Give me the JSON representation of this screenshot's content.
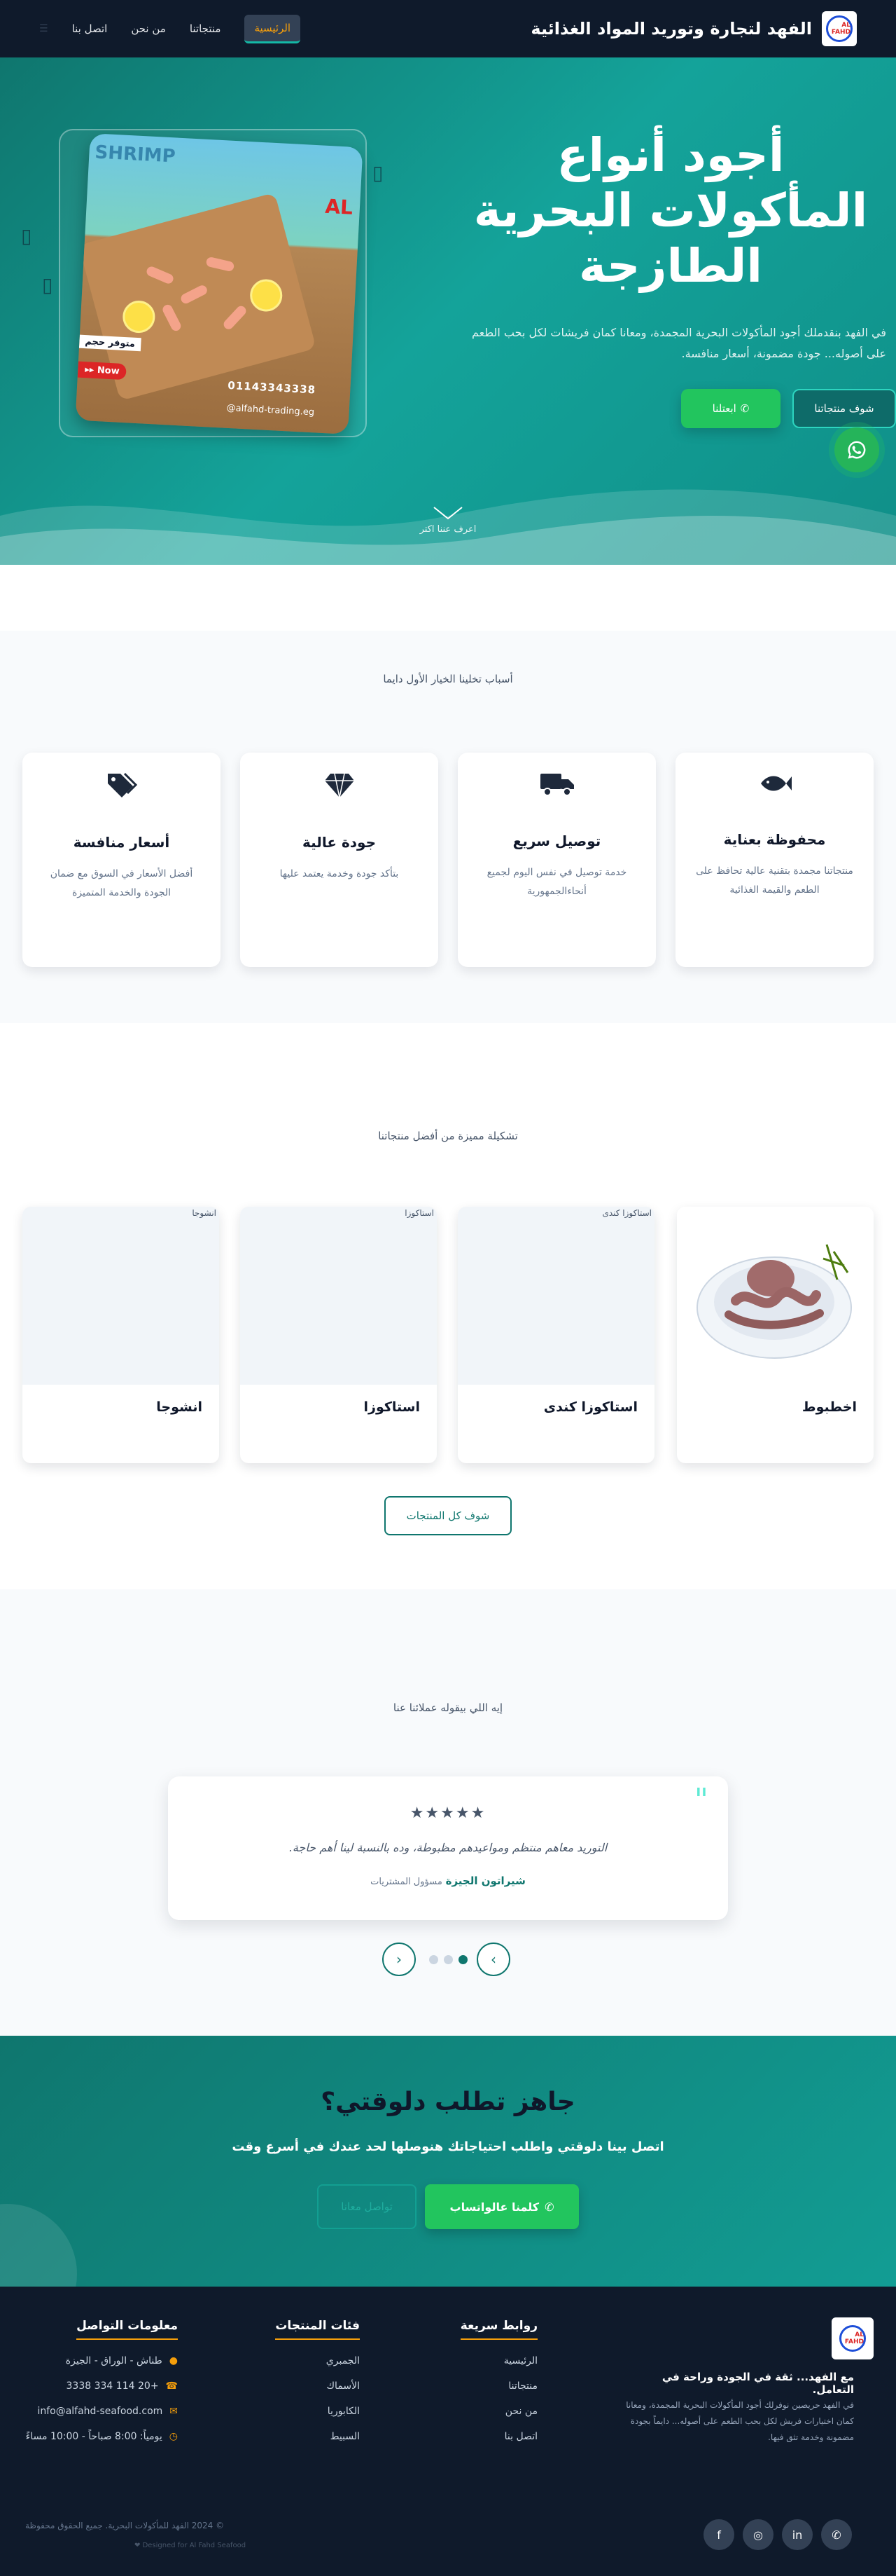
{
  "nav": {
    "brand": "الفهد لتجارة وتوريد المواد الغذائية",
    "logo_text": "AL FAHD",
    "items": [
      {
        "label": "الرئيسية",
        "active": true
      },
      {
        "label": "منتجاتنا",
        "active": false
      },
      {
        "label": "من نحن",
        "active": false
      },
      {
        "label": "اتصل بنا",
        "active": false
      }
    ]
  },
  "hero": {
    "title_line1": "أجود أنواع",
    "title_line2": "المأكولات البحرية",
    "title_line3": "الطازجة",
    "description": "في الفهد بنقدملك أجود المأكولات البحرية المجمدة، ومعانا كمان فريشات لكل بحب الطعم على أصوله... جودة مضمونة، أسعار منافسة.",
    "btn_products": "شوف منتجاتنا",
    "btn_contact": "ابعتلنا",
    "scroll_hint": "اعرف عننا اكتر",
    "image": {
      "word": "SHRIMP",
      "al": "AL",
      "tag1": "متوفر حجم",
      "tag2": "Now ▸▸",
      "phone": "01143343338",
      "site": "alfahd-trading.eg@"
    }
  },
  "why": {
    "subtitle": "أسباب تخلينا الخيار الأول دايما",
    "cards": [
      {
        "title": "محفوظة بعناية",
        "text": "منتجاتنا مجمدة بتقنية عالية تحافظ على الطعم والقيمة الغذائية"
      },
      {
        "title": "توصيل سريع",
        "text": "خدمة توصيل في نفس اليوم لجميع أنحاءالجمهورية"
      },
      {
        "title": "جودة عالية",
        "text": "بتأكد جودة وخدمة يعتمد عليها"
      },
      {
        "title": "أسعار منافسة",
        "text": "أفضل الأسعار في السوق مع ضمان الجودة والخدمة المتميزة"
      }
    ]
  },
  "products": {
    "subtitle": "تشكيلة مميزة من أفضل منتجاتنا",
    "items": [
      {
        "name": "اخطبوط",
        "alt": ""
      },
      {
        "name": "استاكوزا كندى",
        "alt": "استاكوزا كندى"
      },
      {
        "name": "استاكوزا",
        "alt": "استاكوزا"
      },
      {
        "name": "انشوجا",
        "alt": "انشوجا"
      }
    ],
    "btn_all": "شوف كل المنتجات"
  },
  "testimonials": {
    "subtitle": "إيه اللي بيقوله عملائنا عنا",
    "stars": "★★★★★",
    "text": "التوريد معاهم منتظم ومواعيدهم مظبوطة، وده بالنسبة لينا أهم حاجة.",
    "author": "شيراتون الجيزة",
    "role": "مسؤول المشتريات"
  },
  "cta": {
    "title": "جاهز تطلب دلوقتي؟",
    "subtitle": "اتصل بينا دلوقتي واطلب احتياجاتك هنوصلها لحد عندك في أسرع وقت",
    "btn_whatsapp": "كلمنا عالواتساب",
    "btn_message": "تواصل معانا"
  },
  "footer": {
    "tagline": "مع الفهد... ثقة في الجودة وراحة في التعامل.",
    "description": "في الفهد حريصين نوفرلك أجود المأكولات البحرية المجمدة، ومعانا كمان اختيارات فريش لكل بحب الطعم على أصوله... دايماً بجودة مضمونة وخدمة تثق فيها.",
    "quick_links_title": "روابط سريعة",
    "quick_links": [
      "الرئيسية",
      "منتجاتنا",
      "من نحن",
      "اتصل بنا"
    ],
    "categories_title": "فئات المنتجات",
    "categories": [
      "الجمبري",
      "الأسماك",
      "الكابوريا",
      "السبيط"
    ],
    "contact_title": "معلومات التواصل",
    "contact": [
      {
        "icon": "location-icon",
        "text": "طناش - الوراق - الجيزة"
      },
      {
        "icon": "phone-icon",
        "text": "+20 114 334 3338"
      },
      {
        "icon": "mail-icon",
        "text": "info@alfahd-seafood.com"
      },
      {
        "icon": "clock-icon",
        "text": "يومياً: 8:00 صباحاً - 10:00 مساءً"
      }
    ],
    "copyright": "© 2024 الفهد للمأكولات البحرية. جميع الحقوق محفوظة",
    "credit": "Designed for Al Fahd Seafood ❤"
  },
  "colors": {
    "primary": "#0f766e",
    "accent": "#f59e0b",
    "whatsapp": "#22c55e",
    "dark": "#0f1a2b"
  }
}
